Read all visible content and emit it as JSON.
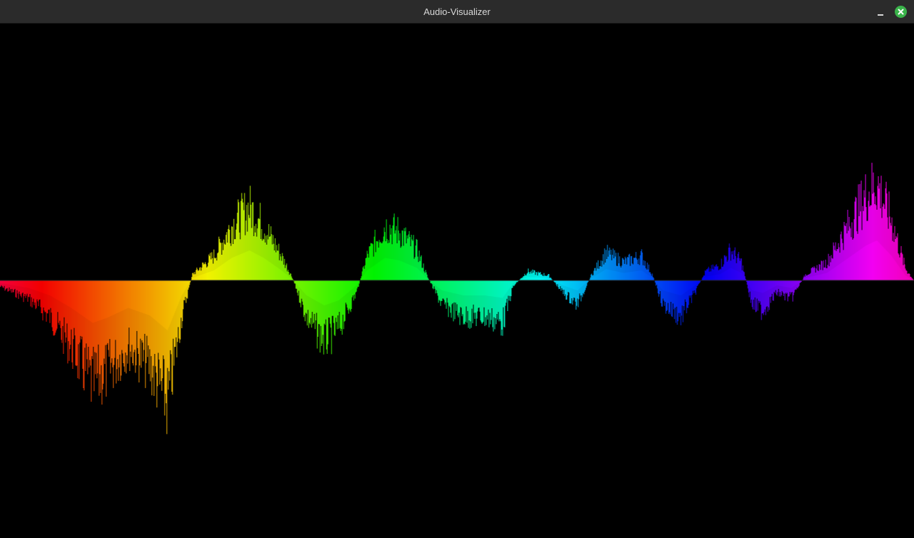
{
  "window": {
    "title": "Audio-Visualizer",
    "minimize_icon": "minimize-icon",
    "close_icon": "close-icon",
    "close_color": "#3ab34a"
  },
  "visualizer": {
    "background": "#000000",
    "color_gradient": [
      "#ff0066",
      "#ff0000",
      "#ff9900",
      "#ffff00",
      "#66ff00",
      "#00ff00",
      "#00ffcc",
      "#00ccff",
      "#0066ff",
      "#0000ff",
      "#6600ff",
      "#cc00ff",
      "#ff00cc"
    ]
  }
}
